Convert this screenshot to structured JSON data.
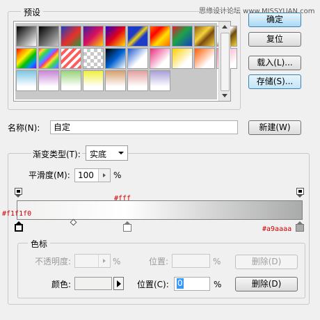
{
  "watermark": "思缘设计论坛 www.MISSYUAN.com",
  "presets": {
    "label": "预设",
    "swatches": [
      "linear-gradient(135deg,#000 0%,#fff 100%)",
      "linear-gradient(135deg,#000 0%,rgba(0,0,0,0) 100%)",
      "linear-gradient(135deg,#1a3fc0 0%,#e8302a 55%,#1f9a3a 100%)",
      "linear-gradient(135deg,#3e1fa0 0%,#d81060 50%,#ffcf00 100%)",
      "linear-gradient(135deg,#2200c8 0%,#e0001c 50%,#ffe000 100%)",
      "linear-gradient(135deg,#1c3cc8 0%,#1c3cc8 35%,#f4d010 50%,#1c3cc8 65%,#1c3cc8 100%)",
      "linear-gradient(135deg,#ff6a00 0%,#ff0000 30%,#ffe000 60%,#ff6a00 100%)",
      "linear-gradient(135deg,#e31d2c 0%,#1aa34a 45%,#1a3fc0 100%)",
      "linear-gradient(135deg,#8a5b14 0%,#f6d23c 40%,#7a4c10 60%,#f6d23c 100%)",
      "linear-gradient(135deg,#fff 0%,#fff 40%,#6d4a10 60%,#f6d23c 100%)",
      "linear-gradient(135deg,#ff0000,#ff8c00,#ffee00,#00c000,#0090ff,#7a00ff)",
      "repeating-linear-gradient(135deg,#ff3c3c 0px,#ffd93c 5px,#3cd93c 10px,#3c9cff 15px,#c03cff 20px)",
      "repeating-linear-gradient(135deg,#ffffff 0px,#ffffff 4px,#ff5c5c 4px,#ff5c5c 8px)",
      "repeating-conic-gradient(#c8c8c8 0% 25%,#ffffff 0% 50%) 0 0/10px 10px",
      "linear-gradient(135deg,#000 0%,#0060d0 50%,#fff 100%)",
      "linear-gradient(135deg,#1e5ad0 0%,#ffffff 60%)",
      "linear-gradient(135deg,#e83080 0%,#ffffff 70%)",
      "linear-gradient(135deg,#ffd000 0%,#ffffff 70%)",
      "linear-gradient(135deg,#ff5c00 0%,#ffffff 70%)",
      "linear-gradient(135deg,#f28fb4 0%,#ffffff 80%)",
      "linear-gradient(180deg,#7fc8e4 0%,#ffffff 80%)",
      "linear-gradient(180deg,#c888d8 0%,#ffffff 80%)",
      "linear-gradient(180deg,#9ad47a 0%,#ffffff 80%)",
      "linear-gradient(180deg,#f0f040 0%,#ffffff 80%)",
      "linear-gradient(180deg,#d8a070 0%,#ffffff 80%)",
      "linear-gradient(180deg,#e4a0a0 0%,#ffffff 80%)",
      "linear-gradient(180deg,#a8a0d8 0%,#ffffff 80%)"
    ]
  },
  "buttons": {
    "ok": "确定",
    "reset": "复位",
    "load": "载入(L)...",
    "save": "存储(S)...",
    "new": "新建(W)"
  },
  "name": {
    "label": "名称(N):",
    "value": "自定"
  },
  "gradient_type": {
    "label": "渐变类型(T):",
    "value": "实底"
  },
  "smoothness": {
    "label": "平滑度(M):",
    "value": "100",
    "unit": "%"
  },
  "gradient_bar": {
    "start_color": "#f1f1f0",
    "mid_color": "#ffffff",
    "end_color": "#a9aaaa",
    "annotation_left": "#f1f1f0",
    "annotation_mid": "#fff",
    "annotation_right": "#a9aaaa"
  },
  "stops": {
    "label": "色标",
    "opacity_label": "不透明度:",
    "opacity_unit": "%",
    "opacity_position_label": "位置:",
    "opacity_position_unit": "%",
    "delete_label": "删除(D)",
    "color_label": "颜色:",
    "position_label": "位置(C):",
    "position_value": "0",
    "position_unit": "%",
    "color_delete_label": "删除(D)"
  }
}
